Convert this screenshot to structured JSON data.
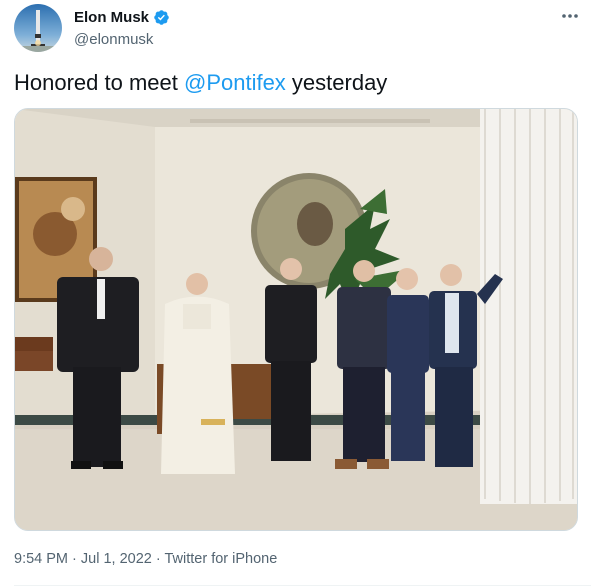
{
  "author": {
    "name": "Elon Musk",
    "handle": "@elonmusk",
    "verified_icon": "verified-badge-icon",
    "avatar_icon": "rocket-avatar-icon"
  },
  "menu_icon": "more-horizontal-icon",
  "tweet": {
    "text_before": "Honored to meet ",
    "mention": "@Pontifex",
    "text_after": " yesterday"
  },
  "media": {
    "type": "photo"
  },
  "meta": {
    "time": "9:54 PM",
    "separator": " · ",
    "date": "Jul 1, 2022",
    "source": "Twitter for iPhone"
  },
  "colors": {
    "link": "#1d9bf0",
    "secondary_text": "#536471",
    "verified": "#1d9bf0"
  }
}
